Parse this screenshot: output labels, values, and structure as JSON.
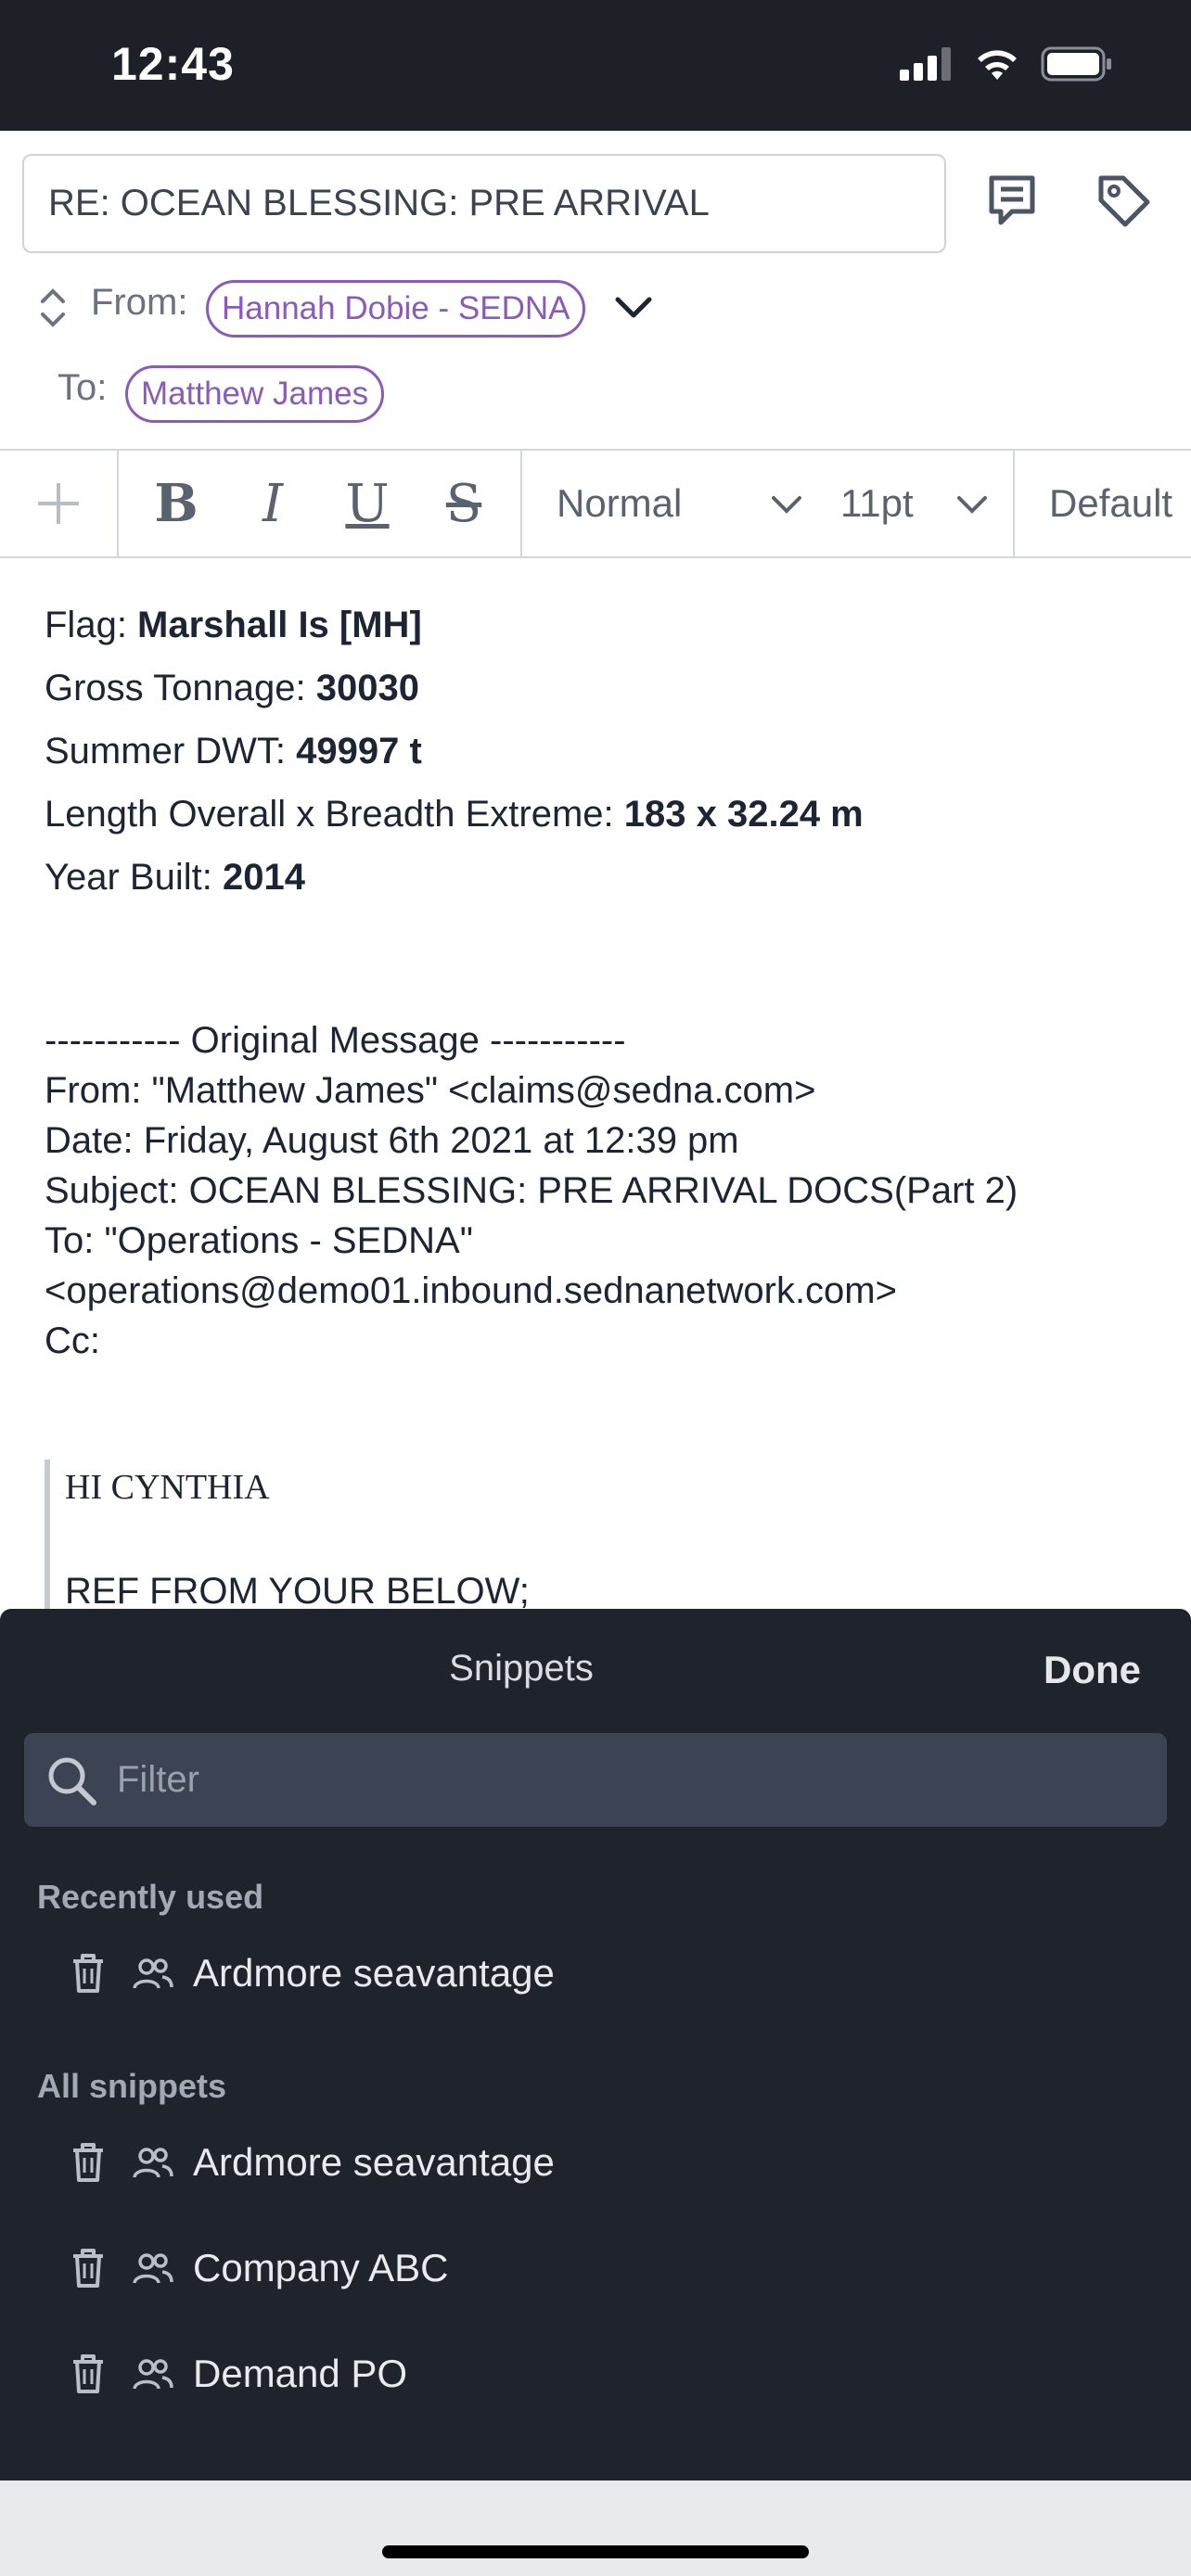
{
  "status_bar": {
    "time": "12:43"
  },
  "header": {
    "subject": "RE: OCEAN BLESSING:  PRE ARRIVAL",
    "from_label": "From:",
    "from_chip": "Hannah Dobie - SEDNA",
    "to_label": "To:",
    "to_chip": "Matthew James",
    "accent_color": "#8b5bb8"
  },
  "toolbar": {
    "add": "+",
    "bold": "B",
    "italic": "I",
    "underline": "U",
    "strike": "S",
    "style_value": "Normal",
    "size_value": "11pt",
    "font_value": "Default"
  },
  "body": {
    "flag_label": "Flag: ",
    "flag_value": "Marshall Is [MH]",
    "gross_label": "Gross Tonnage: ",
    "gross_value": "30030",
    "dwt_label": "Summer DWT: ",
    "dwt_value": "49997 t",
    "loa_label": "Length Overall x Breadth Extreme: ",
    "loa_value": "183 x 32.24 m",
    "year_label": "Year Built: ",
    "year_value": "2014",
    "original_lines": [
      "----------- Original Message -----------",
      "From: \"Matthew James\" <claims@sedna.com>",
      "Date: Friday, August 6th 2021 at 12:39 pm",
      "Subject: OCEAN BLESSING: PRE ARRIVAL DOCS(Part 2)",
      "To: \"Operations - SEDNA\"",
      "<operations@demo01.inbound.sednanetwork.com>",
      "Cc:"
    ],
    "quote_lines": [
      "HI CYNTHIA",
      "REF FROM YOUR BELOW;"
    ]
  },
  "snippets": {
    "title": "Snippets",
    "done": "Done",
    "filter_placeholder": "Filter",
    "recent_label": "Recently used",
    "recent": [
      {
        "label": "Ardmore seavantage"
      }
    ],
    "all_label": "All snippets",
    "all": [
      {
        "label": "Ardmore seavantage"
      },
      {
        "label": "Company ABC"
      },
      {
        "label": "Demand PO"
      }
    ]
  }
}
